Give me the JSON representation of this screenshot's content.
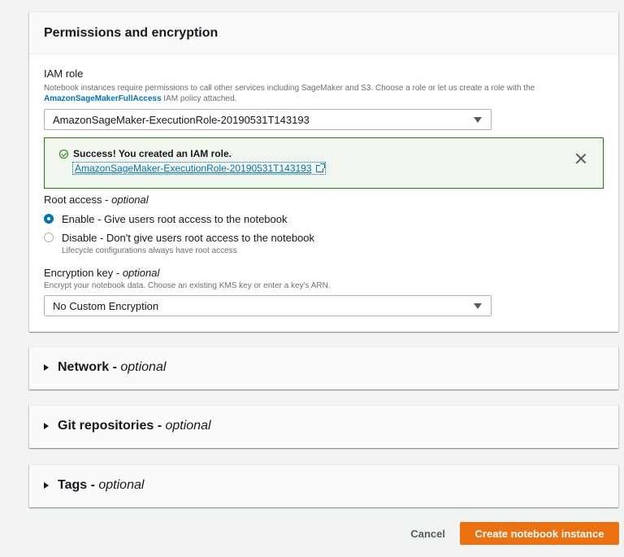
{
  "permissions": {
    "title": "Permissions and encryption",
    "iam_role": {
      "label": "IAM role",
      "desc_prefix": "Notebook instances require permissions to call other services including SageMaker and S3. Choose a role or let us create a role with the ",
      "desc_link": "AmazonSageMakerFullAccess",
      "desc_suffix": " IAM policy attached.",
      "selected": "AmazonSageMaker-ExecutionRole-20190531T143193"
    },
    "flash": {
      "title": "Success! You created an IAM role.",
      "link": "AmazonSageMaker-ExecutionRole-20190531T143193"
    },
    "root_access": {
      "label": "Root access",
      "optional": "optional",
      "options": [
        {
          "label": "Enable - Give users root access to the notebook",
          "sub": "",
          "checked": true
        },
        {
          "label": "Disable - Don't give users root access to the notebook",
          "sub": "Lifecycle configurations always have root access",
          "checked": false
        }
      ]
    },
    "encryption": {
      "label": "Encryption key",
      "optional": "optional",
      "desc": "Encrypt your notebook data. Choose an existing KMS key or enter a key's ARN.",
      "selected": "No Custom Encryption"
    }
  },
  "sections": {
    "network": {
      "title": "Network",
      "optional": "optional"
    },
    "git": {
      "title": "Git repositories",
      "optional": "optional"
    },
    "tags": {
      "title": "Tags",
      "optional": "optional"
    }
  },
  "footer": {
    "cancel": "Cancel",
    "create": "Create notebook instance"
  },
  "colors": {
    "accent": "#ec7211",
    "link": "#0073bb",
    "success": "#1d8102"
  }
}
